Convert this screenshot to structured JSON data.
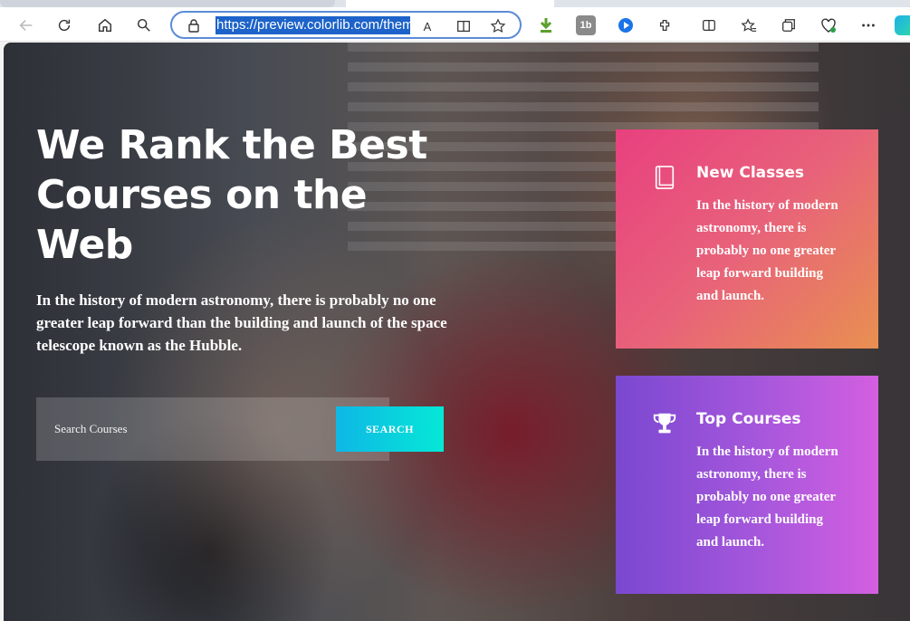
{
  "browser": {
    "url": "https://preview.colorlib.com/theme",
    "read_aloud_label": "A",
    "extension_label": "1b"
  },
  "hero": {
    "title": "We Rank the Best Courses on the Web",
    "text": "In the history of modern astronomy, there is probably no one greater leap forward than the building and launch of the space telescope known as the Hubble."
  },
  "search": {
    "placeholder": "Search Courses",
    "button_label": "SEARCH"
  },
  "cards": {
    "new_classes": {
      "title": "New Classes",
      "text": "In the history of modern astronomy, there is probably no one greater leap forward building and launch.",
      "icon": "book-icon"
    },
    "top_courses": {
      "title": "Top Courses",
      "text": "In the history of modern astronomy, there is probably no one greater leap forward building and launch.",
      "icon": "trophy-icon"
    }
  },
  "colors": {
    "accent_blue": "#1d63c9",
    "search_gradient_start": "#0fb7e6",
    "search_gradient_end": "#05e8d6",
    "card_new_start": "#e8407f",
    "card_new_end": "#e89051",
    "card_top_start": "#7a48d0",
    "card_top_end": "#d45fe0"
  }
}
